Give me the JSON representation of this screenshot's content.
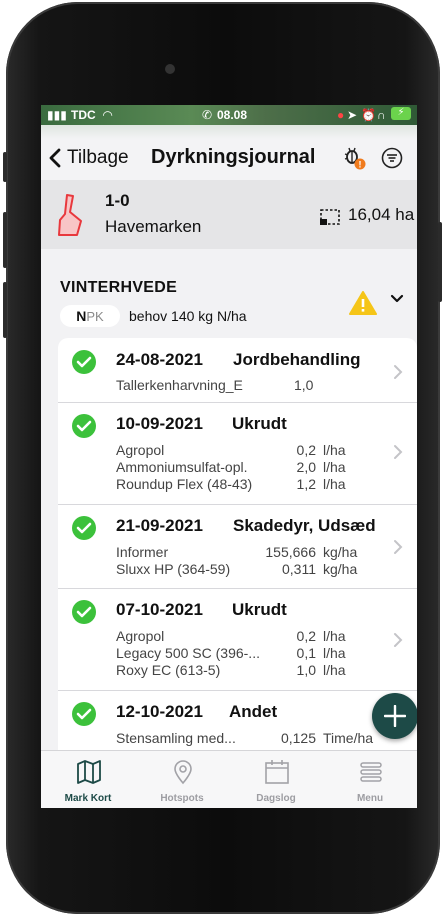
{
  "status": {
    "carrier": "TDC",
    "time": "08.08"
  },
  "header": {
    "back_label": "Tilbage",
    "title": "Dyrkningsjournal"
  },
  "field": {
    "code": "1-0",
    "name": "Havemarken",
    "area": "16,04 ha"
  },
  "crop": {
    "name": "VINTERHVEDE",
    "npk_n": "N",
    "npk_rest": "PK",
    "requirement": "behov 140 kg N/ha"
  },
  "entries": [
    {
      "date": "24-08-2021",
      "category": "Jordbehandling",
      "lines": [
        {
          "product": "Tallerkenharvning_E",
          "amount": "1,0",
          "unit": ""
        }
      ]
    },
    {
      "date": "10-09-2021",
      "category": "Ukrudt",
      "lines": [
        {
          "product": "Agropol",
          "amount": "0,2",
          "unit": "l/ha"
        },
        {
          "product": "Ammoniumsulfat-opl.",
          "amount": "2,0",
          "unit": "l/ha"
        },
        {
          "product": "Roundup Flex (48-43)",
          "amount": "1,2",
          "unit": "l/ha"
        }
      ]
    },
    {
      "date": "21-09-2021",
      "category": "Skadedyr, Udsæd",
      "lines": [
        {
          "product": "Informer",
          "amount": "155,666",
          "unit": "kg/ha"
        },
        {
          "product": "Sluxx HP (364-59)",
          "amount": "0,311",
          "unit": "kg/ha"
        }
      ]
    },
    {
      "date": "07-10-2021",
      "category": "Ukrudt",
      "lines": [
        {
          "product": "Agropol",
          "amount": "0,2",
          "unit": "l/ha"
        },
        {
          "product": "Legacy 500 SC (396-...",
          "amount": "0,1",
          "unit": "l/ha"
        },
        {
          "product": "Roxy EC (613-5)",
          "amount": "1,0",
          "unit": "l/ha"
        }
      ]
    },
    {
      "date": "12-10-2021",
      "category": "Andet",
      "lines": [
        {
          "product": "Stensamling med...",
          "amount": "0,125",
          "unit": "Time/ha"
        }
      ]
    }
  ],
  "tabs": [
    {
      "label": "Mark Kort",
      "icon": "map-icon",
      "active": true
    },
    {
      "label": "Hotspots",
      "icon": "location-pin-icon",
      "active": false
    },
    {
      "label": "Dagslog",
      "icon": "calendar-icon",
      "active": false
    },
    {
      "label": "Menu",
      "icon": "menu-icon",
      "active": false
    }
  ],
  "colors": {
    "accent": "#1d4a47",
    "check": "#3cc13b",
    "warning": "#f5c518",
    "field_outline": "#e8383d"
  }
}
